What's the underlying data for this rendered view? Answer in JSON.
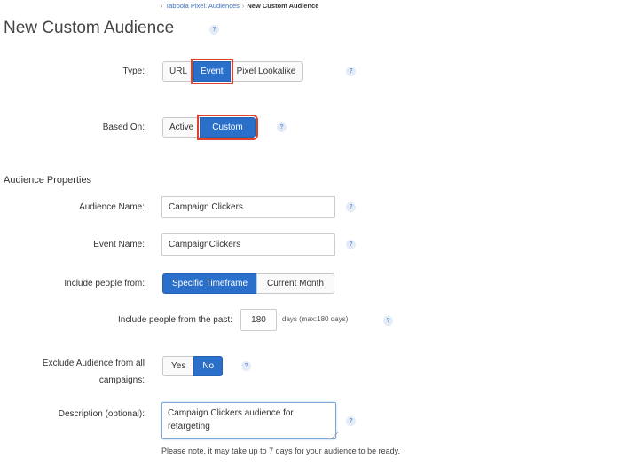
{
  "breadcrumb": {
    "items": [
      "Taboola Pixel: Audiences"
    ],
    "current": "New Custom Audience"
  },
  "page": {
    "title": "New Custom Audience",
    "help_glyph": "?"
  },
  "type": {
    "label": "Type:",
    "options": [
      "URL",
      "Event",
      "Pixel Lookalike"
    ],
    "selected": "Event"
  },
  "based_on": {
    "label": "Based On:",
    "options": [
      "Active",
      "Custom"
    ],
    "selected": "Custom"
  },
  "properties": {
    "heading": "Audience Properties",
    "audience_name": {
      "label": "Audience Name:",
      "value": "Campaign Clickers"
    },
    "event_name": {
      "label": "Event Name:",
      "value": "CampaignClickers"
    },
    "include_from": {
      "label": "Include people from:",
      "options": [
        "Specific Timeframe",
        "Current Month"
      ],
      "selected": "Specific Timeframe"
    },
    "include_past": {
      "label": "Include people from the past:",
      "value": "180",
      "suffix": "days (max:180 days)"
    },
    "exclude": {
      "label_line1": "Exclude Audience from all",
      "label_line2": "campaigns:",
      "options": [
        "Yes",
        "No"
      ],
      "selected": "No"
    },
    "description": {
      "label": "Description (optional):",
      "value": "Campaign Clickers audience for retargeting"
    },
    "note": "Please note, it may take up to 7 days for your audience to be ready."
  },
  "colors": {
    "accent": "#2a6fc9",
    "highlight": "#e0402e",
    "link": "#3b73b9"
  }
}
